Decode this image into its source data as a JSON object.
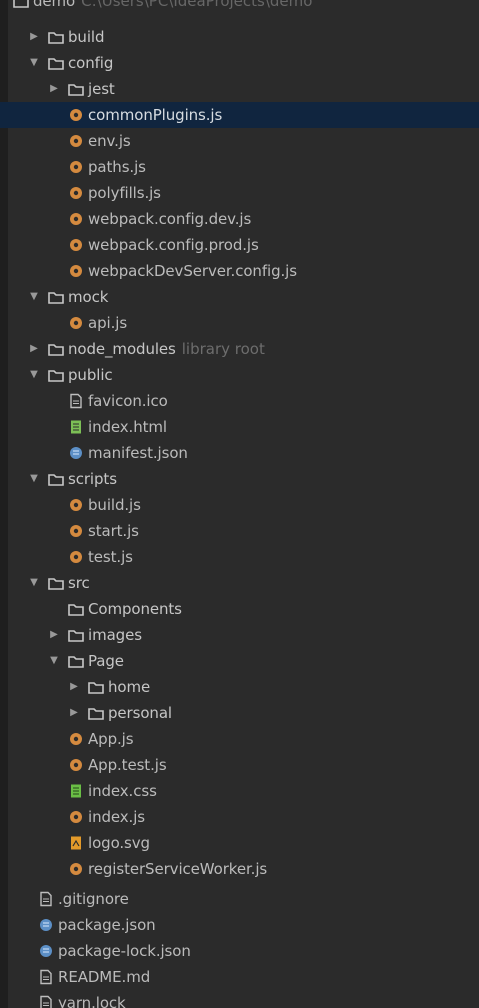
{
  "tree": {
    "partial_root": {
      "label": "demo",
      "path": "C:\\Users\\PC\\IdeaProjects\\demo"
    },
    "items": [
      {
        "label": "build",
        "type": "folder",
        "expanded": false
      },
      {
        "label": "config",
        "type": "folder",
        "expanded": true
      },
      {
        "label": "jest",
        "type": "folder",
        "expanded": false
      },
      {
        "label": "commonPlugins.js",
        "type": "js",
        "selected": true
      },
      {
        "label": "env.js",
        "type": "js"
      },
      {
        "label": "paths.js",
        "type": "js"
      },
      {
        "label": "polyfills.js",
        "type": "js"
      },
      {
        "label": "webpack.config.dev.js",
        "type": "js"
      },
      {
        "label": "webpack.config.prod.js",
        "type": "js"
      },
      {
        "label": "webpackDevServer.config.js",
        "type": "js"
      },
      {
        "label": "mock",
        "type": "folder",
        "expanded": true
      },
      {
        "label": "api.js",
        "type": "js"
      },
      {
        "label": "node_modules",
        "type": "folder",
        "expanded": false,
        "suffix": "library root"
      },
      {
        "label": "public",
        "type": "folder",
        "expanded": true
      },
      {
        "label": "favicon.ico",
        "type": "file"
      },
      {
        "label": "index.html",
        "type": "html"
      },
      {
        "label": "manifest.json",
        "type": "json"
      },
      {
        "label": "scripts",
        "type": "folder",
        "expanded": true
      },
      {
        "label": "build.js",
        "type": "js"
      },
      {
        "label": "start.js",
        "type": "js"
      },
      {
        "label": "test.js",
        "type": "js"
      },
      {
        "label": "src",
        "type": "folder",
        "expanded": true
      },
      {
        "label": "Components",
        "type": "folder"
      },
      {
        "label": "images",
        "type": "folder",
        "expanded": false
      },
      {
        "label": "Page",
        "type": "folder",
        "expanded": true
      },
      {
        "label": "home",
        "type": "folder",
        "expanded": false
      },
      {
        "label": "personal",
        "type": "folder",
        "expanded": false
      },
      {
        "label": "App.js",
        "type": "js"
      },
      {
        "label": "App.test.js",
        "type": "js"
      },
      {
        "label": "index.css",
        "type": "css"
      },
      {
        "label": "index.js",
        "type": "js"
      },
      {
        "label": "logo.svg",
        "type": "svg"
      },
      {
        "label": "registerServiceWorker.js",
        "type": "js"
      },
      {
        "label": ".gitignore",
        "type": "file"
      },
      {
        "label": "package.json",
        "type": "json"
      },
      {
        "label": "package-lock.json",
        "type": "json"
      },
      {
        "label": "README.md",
        "type": "file"
      },
      {
        "label": "yarn.lock",
        "type": "file"
      }
    ]
  },
  "colors": {
    "background": "#2b2b2b",
    "selected_row": "#10253f",
    "folder": "#c8c8c8",
    "js": "#d48a3f",
    "html": "#7cbf56",
    "css": "#6abe45",
    "json": "#5c8fc6",
    "svg": "#e39a2a",
    "text": "#bbbbbb",
    "muted_text": "#6d6d6d"
  }
}
